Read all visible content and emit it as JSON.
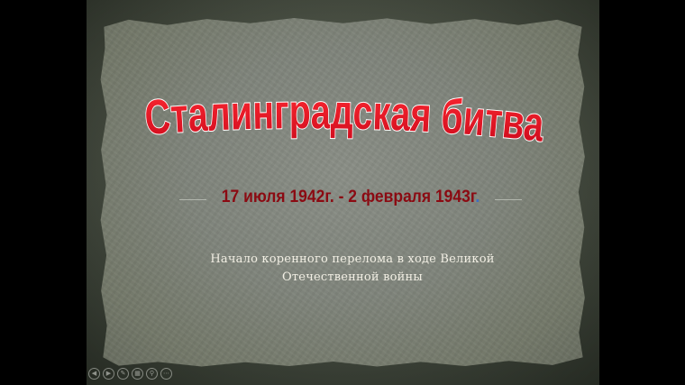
{
  "slide": {
    "title": "Сталинградская битва",
    "dates": {
      "start": "17 июля 1942г.",
      "separator": " - ",
      "end": "2 февраля 1943г",
      "trailing_mark": "."
    },
    "subtitle_line1": "Начало коренного перелома в ходе Великой",
    "subtitle_line2": "Отечественной войны"
  },
  "toolbar": {
    "buttons": [
      {
        "name": "previous-slide-icon",
        "glyph": "◀"
      },
      {
        "name": "next-slide-icon",
        "glyph": "▶"
      },
      {
        "name": "pen-icon",
        "glyph": "✎"
      },
      {
        "name": "slides-icon",
        "glyph": "▦"
      },
      {
        "name": "zoom-icon",
        "glyph": "⚲"
      },
      {
        "name": "more-icon",
        "glyph": "⋯"
      }
    ]
  },
  "colors": {
    "background": "#000000",
    "paper": "#7f847b",
    "title_fill": "#e3101e",
    "title_outline": "#ffffff",
    "dates": "#8b0a12",
    "subtitle": "#f2efe4"
  }
}
